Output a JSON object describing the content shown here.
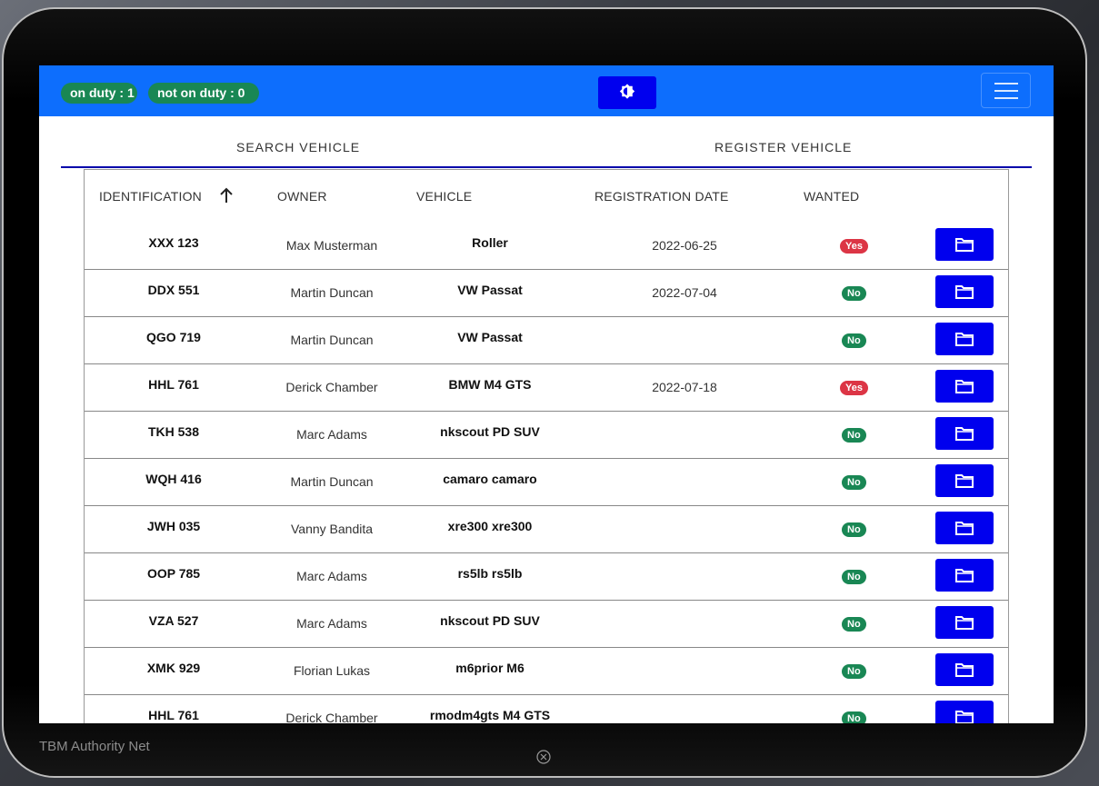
{
  "status": {
    "on_duty_label": "on duty : 1",
    "not_on_duty_label": "not on duty : 0"
  },
  "icons": {
    "theme": "brightness-icon",
    "menu": "hamburger-icon",
    "sort": "arrow-up-icon",
    "open": "folder-icon",
    "close": "close-circle-icon"
  },
  "tabs": [
    {
      "label": "SEARCH VEHICLE"
    },
    {
      "label": "REGISTER VEHICLE"
    }
  ],
  "table": {
    "headers": {
      "identification": "IDENTIFICATION",
      "owner": "OWNER",
      "vehicle": "VEHICLE",
      "registration_date": "REGISTRATION DATE",
      "wanted": "WANTED"
    },
    "rows": [
      {
        "id": "XXX 123",
        "owner": "Max Musterman",
        "vehicle": "Roller",
        "date": "2022-06-25",
        "wanted": "Yes"
      },
      {
        "id": "DDX 551",
        "owner": "Martin Duncan",
        "vehicle": "VW Passat",
        "date": "2022-07-04",
        "wanted": "No"
      },
      {
        "id": "QGO 719",
        "owner": "Martin Duncan",
        "vehicle": "VW Passat",
        "date": "",
        "wanted": "No"
      },
      {
        "id": "HHL 761",
        "owner": "Derick Chamber",
        "vehicle": "BMW M4 GTS",
        "date": "2022-07-18",
        "wanted": "Yes"
      },
      {
        "id": "TKH 538",
        "owner": "Marc Adams",
        "vehicle": "nkscout PD SUV",
        "date": "",
        "wanted": "No"
      },
      {
        "id": "WQH 416",
        "owner": "Martin Duncan",
        "vehicle": "camaro camaro",
        "date": "",
        "wanted": "No"
      },
      {
        "id": "JWH 035",
        "owner": "Vanny Bandita",
        "vehicle": "xre300 xre300",
        "date": "",
        "wanted": "No"
      },
      {
        "id": "OOP 785",
        "owner": "Marc Adams",
        "vehicle": "rs5lb rs5lb",
        "date": "",
        "wanted": "No"
      },
      {
        "id": "VZA 527",
        "owner": "Marc Adams",
        "vehicle": "nkscout PD SUV",
        "date": "",
        "wanted": "No"
      },
      {
        "id": "XMK 929",
        "owner": "Florian Lukas",
        "vehicle": "m6prior M6",
        "date": "",
        "wanted": "No"
      },
      {
        "id": "HHL 761",
        "owner": "Derick Chamber",
        "vehicle": "rmodm4gts M4 GTS",
        "date": "",
        "wanted": "No"
      }
    ]
  },
  "footer": {
    "brand": "TBM Authority Net"
  },
  "colors": {
    "primary": "#0d6efd",
    "button": "#0000ee",
    "success": "#198754",
    "danger": "#dc3545"
  }
}
